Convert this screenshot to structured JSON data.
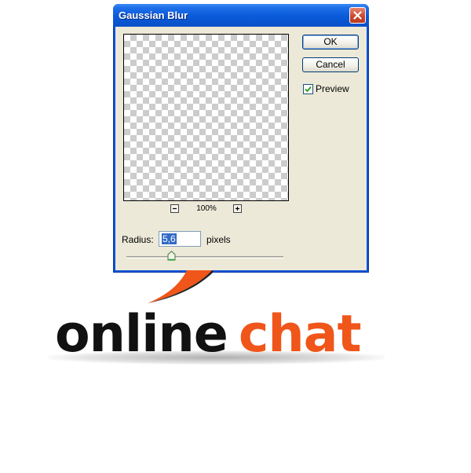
{
  "dialog": {
    "title": "Gaussian Blur",
    "zoom_level": "100%",
    "ok_label": "OK",
    "cancel_label": "Cancel",
    "preview_label": "Preview",
    "preview_checked": true,
    "radius_label": "Radius:",
    "radius_value": "5,6",
    "radius_unit": "pixels"
  },
  "logo": {
    "word1": "online",
    "word2": "chat",
    "word1_color": "#111111",
    "word2_color": "#f0551a"
  },
  "colors": {
    "titlebar": "#0a5ad9",
    "dialog_bg": "#ece9d8",
    "close_button": "#c8452a",
    "accent_orange": "#f0551a"
  },
  "icons": [
    "close-icon",
    "zoom-out-icon",
    "zoom-in-icon",
    "checkmark-icon",
    "slider-thumb-icon",
    "speech-swoosh-icon"
  ]
}
